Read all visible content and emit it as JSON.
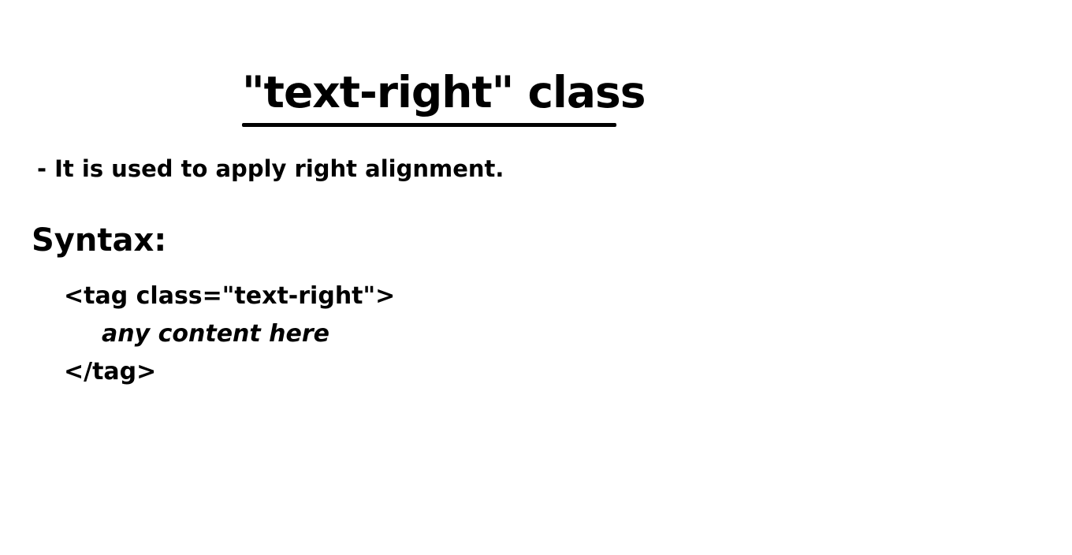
{
  "title": "\"text-right\" class",
  "description": "- It is used to apply right alignment.",
  "syntax": {
    "heading": "Syntax:",
    "lines": [
      "<tag class=\"text-right\">",
      "any content here",
      "</tag>"
    ]
  }
}
